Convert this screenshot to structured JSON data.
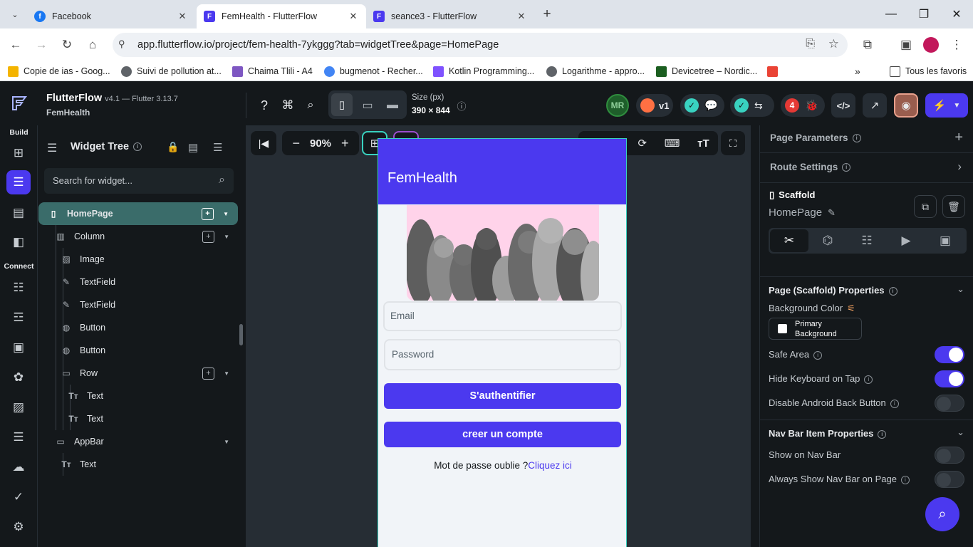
{
  "browser": {
    "tabs": [
      {
        "title": "Facebook",
        "color": "#1877f2",
        "glyph": "f"
      },
      {
        "title": "FemHealth - FlutterFlow",
        "color": "#4b39ef",
        "glyph": "F"
      },
      {
        "title": "seance3 - FlutterFlow",
        "color": "#4b39ef",
        "glyph": "F"
      }
    ],
    "url": "app.flutterflow.io/project/fem-health-7ykggg?tab=widgetTree&page=HomePage",
    "bookmarks": [
      {
        "label": "Copie de ias - Goog...",
        "color": "#f4b400"
      },
      {
        "label": "Suivi de pollution at...",
        "color": "#5f6368"
      },
      {
        "label": "Chaima Tlili - A4",
        "color": "#7e57c2"
      },
      {
        "label": "bugmenot - Recher...",
        "color": "#4285f4"
      },
      {
        "label": "Kotlin Programming...",
        "color": "#7f52ff"
      },
      {
        "label": "Logarithme - appro...",
        "color": "#5f6368"
      },
      {
        "label": "Devicetree – Nordic...",
        "color": "#1b5e20"
      },
      {
        "label": "",
        "color": "#ea4335"
      }
    ],
    "all_bookmarks": "Tous les favoris"
  },
  "ff": {
    "brand": "FlutterFlow",
    "version": "v4.1 — Flutter 3.13.7",
    "project": "FemHealth",
    "size_label": "Size (px)",
    "size_value": "390 × 844",
    "avatar": "MR",
    "version_badge": "v1",
    "error_count": "4"
  },
  "rail": {
    "build": "Build",
    "connect": "Connect"
  },
  "tree": {
    "title": "Widget Tree",
    "search_placeholder": "Search for widget...",
    "items": [
      {
        "label": "HomePage"
      },
      {
        "label": "Column"
      },
      {
        "label": "Image"
      },
      {
        "label": "TextField"
      },
      {
        "label": "TextField"
      },
      {
        "label": "Button"
      },
      {
        "label": "Button"
      },
      {
        "label": "Row"
      },
      {
        "label": "Text"
      },
      {
        "label": "Text"
      },
      {
        "label": "AppBar"
      },
      {
        "label": "Text"
      }
    ]
  },
  "canvas": {
    "zoom": "90%",
    "app_title": "FemHealth",
    "email_placeholder": "Email",
    "password_placeholder": "Password",
    "login_button": "S'authentifier",
    "signup_button": "creer un compte",
    "forgot_text": "Mot de passe oublie ?",
    "forgot_link": "Cliquez ici"
  },
  "props": {
    "page_parameters": "Page Parameters",
    "route_settings": "Route Settings",
    "widget_type": "Scaffold",
    "page_name": "HomePage",
    "scaffold_properties": "Page (Scaffold) Properties",
    "background_color_label": "Background Color",
    "background_color_value": "Primary Background",
    "safe_area": "Safe Area",
    "hide_keyboard": "Hide Keyboard on Tap",
    "disable_back": "Disable Android Back Button",
    "navbar_properties": "Nav Bar Item Properties",
    "show_on_navbar": "Show on Nav Bar",
    "always_show_navbar": "Always Show Nav Bar on Page"
  },
  "colors": {
    "primary": "#4b39ef",
    "accent_teal": "#39d2c0",
    "tree_selected": "#3a6c6a"
  }
}
